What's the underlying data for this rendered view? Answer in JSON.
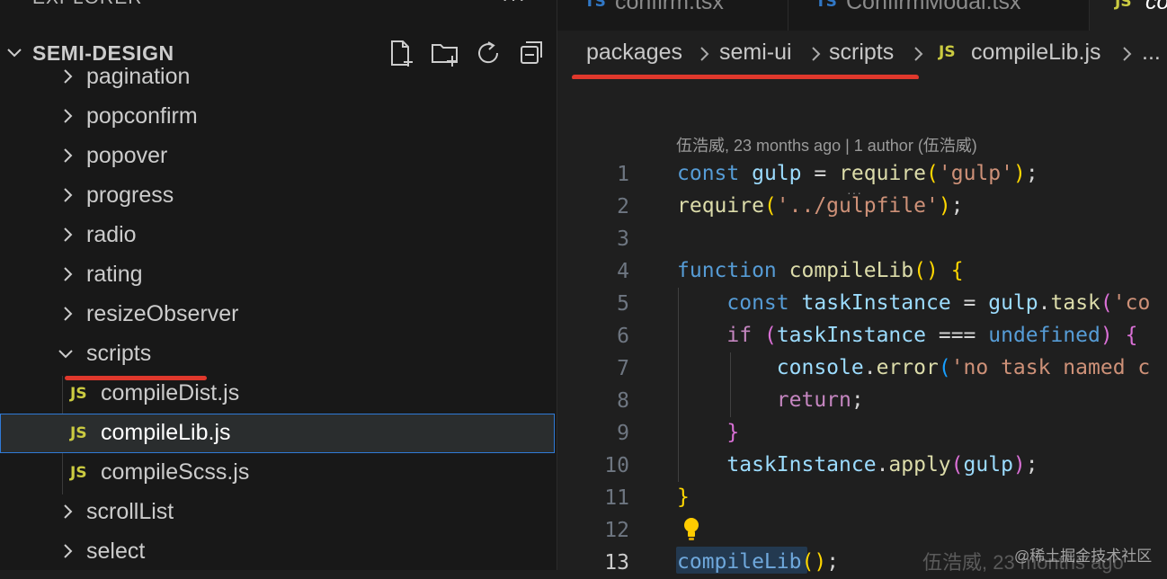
{
  "sidebar": {
    "title": "EXPLORER",
    "more": "···",
    "section_title": "SEMI-DESIGN",
    "actions": [
      "new-file",
      "new-folder",
      "refresh",
      "collapse-all"
    ],
    "items": [
      {
        "label": "pagination",
        "type": "folder"
      },
      {
        "label": "popconfirm",
        "type": "folder"
      },
      {
        "label": "popover",
        "type": "folder"
      },
      {
        "label": "progress",
        "type": "folder"
      },
      {
        "label": "radio",
        "type": "folder"
      },
      {
        "label": "rating",
        "type": "folder"
      },
      {
        "label": "resizeObserver",
        "type": "folder"
      },
      {
        "label": "scripts",
        "type": "folder-open"
      },
      {
        "label": "compileDist.js",
        "type": "js",
        "badge": "JS"
      },
      {
        "label": "compileLib.js",
        "type": "js",
        "badge": "JS",
        "selected": true
      },
      {
        "label": "compileScss.js",
        "type": "js",
        "badge": "JS"
      },
      {
        "label": "scrollList",
        "type": "folder"
      },
      {
        "label": "select",
        "type": "folder"
      }
    ]
  },
  "tabs": [
    {
      "badge": "TS",
      "label": "confirm.tsx"
    },
    {
      "badge": "TS",
      "label": "ConfirmModal.tsx"
    },
    {
      "badge": "JS",
      "label": "co",
      "active": true
    }
  ],
  "breadcrumb": {
    "parts": [
      "packages",
      "semi-ui",
      "scripts"
    ],
    "file_badge": "JS",
    "file": "compileLib.js",
    "ellipsis": "..."
  },
  "editor": {
    "blame_lens": "伍浩威, 23 months ago | 1 author (伍浩威)",
    "line_numbers": [
      "1",
      "2",
      "3",
      "4",
      "5",
      "6",
      "7",
      "8",
      "9",
      "10",
      "11",
      "12",
      "13"
    ],
    "inline_blame": "伍浩威, 23 months ago",
    "lines": [
      "const gulp = require('gulp');",
      "require('../gulpfile');",
      "",
      "function compileLib() {",
      "    const taskInstance = gulp.task('co",
      "    if (taskInstance === undefined) {",
      "        console.error('no task named c",
      "        return;",
      "    }",
      "    taskInstance.apply(gulp);",
      "}",
      "",
      "compileLib();"
    ]
  },
  "watermark": "@稀土掘金技术社区",
  "colors": {
    "accent_underline": "#e0382c",
    "selection_border": "#2f7ad6",
    "js_badge": "#cbcb41",
    "ts_badge": "#3178c6"
  }
}
